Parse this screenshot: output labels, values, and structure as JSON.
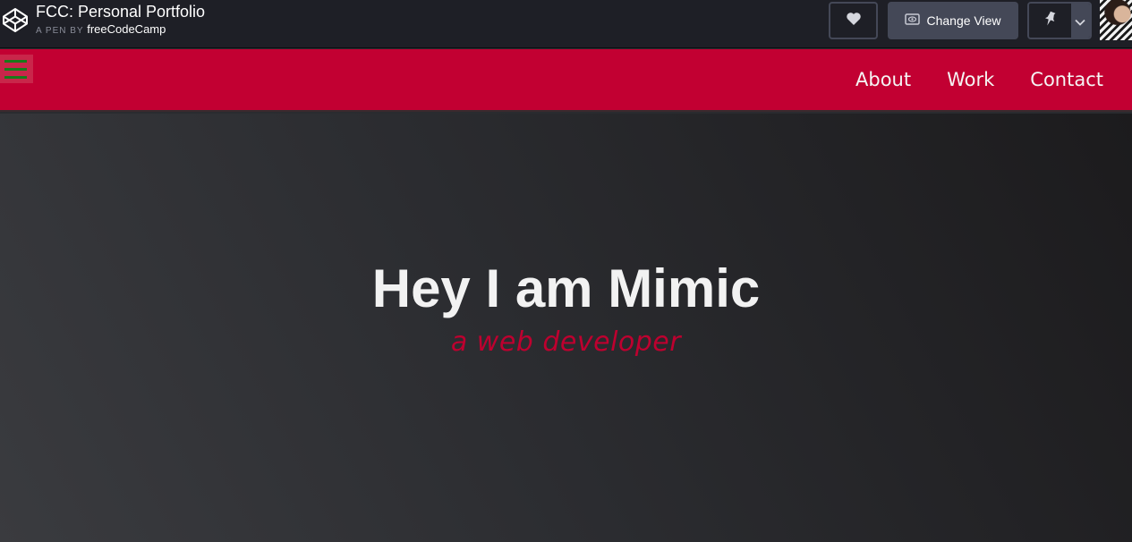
{
  "codepen": {
    "title": "FCC: Personal Portfolio",
    "byline_prefix": "A PEN BY",
    "author": "freeCodeCamp",
    "heart_icon": "heart-icon",
    "change_view_label": "Change View",
    "change_view_icon": "eye-icon",
    "pin_icon": "pin-icon",
    "caret_icon": "chevron-down-icon",
    "colors": {
      "bar": "#1e1f26",
      "button": "#444857"
    }
  },
  "nav": {
    "menu_icon": "hamburger-menu-icon",
    "links": [
      {
        "label": "About"
      },
      {
        "label": "Work"
      },
      {
        "label": "Contact"
      }
    ],
    "colors": {
      "background": "#c20032",
      "menu_lines": "#1a7a1a"
    }
  },
  "hero": {
    "title": "Hey I am Mimic",
    "subtitle": "a web developer",
    "colors": {
      "title": "#f2f2f2",
      "subtitle": "#be002f"
    }
  }
}
